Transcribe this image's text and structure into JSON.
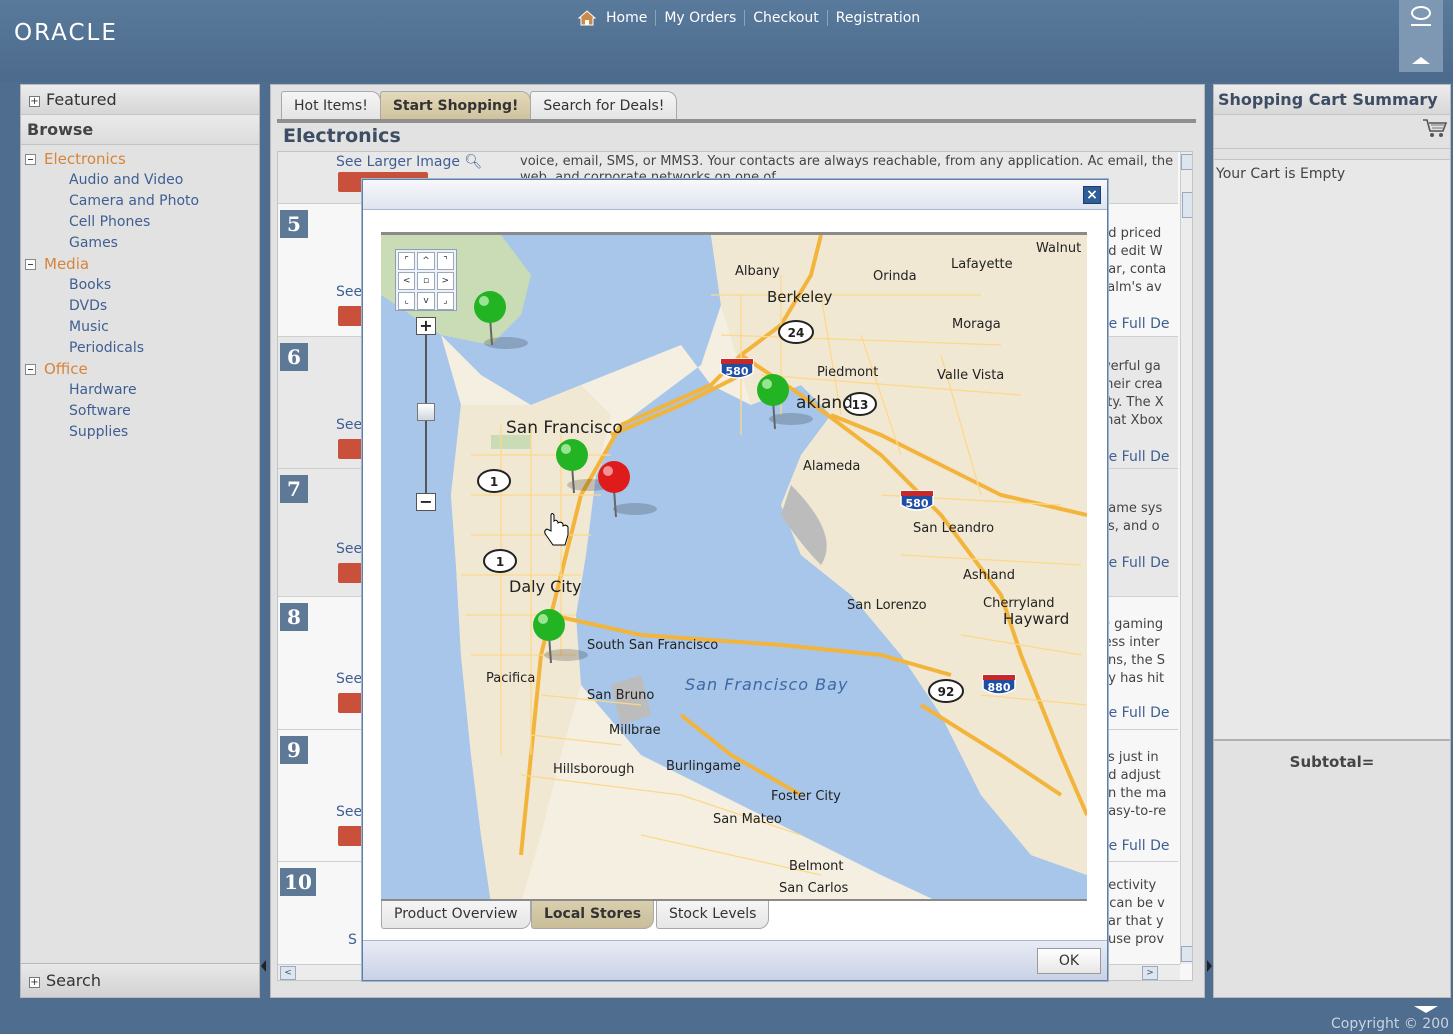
{
  "header": {
    "logo": "ORACLE",
    "logo_mark": "·",
    "nav": [
      "Home",
      "My Orders",
      "Checkout",
      "Registration"
    ]
  },
  "left": {
    "featured": "Featured",
    "browse": "Browse",
    "categories": [
      {
        "label": "Electronics",
        "items": [
          "Audio and Video",
          "Camera and Photo",
          "Cell Phones",
          "Games"
        ]
      },
      {
        "label": "Media",
        "items": [
          "Books",
          "DVDs",
          "Music",
          "Periodicals"
        ]
      },
      {
        "label": "Office",
        "items": [
          "Hardware",
          "Software",
          "Supplies"
        ]
      }
    ],
    "search": "Search"
  },
  "center": {
    "tabs": [
      "Hot Items!",
      "Start Shopping!",
      "Search for Deals!"
    ],
    "active_tab": "Start Shopping!",
    "section_title": "Electronics",
    "top_row": {
      "see_larger": "See Larger Image",
      "description": "voice, email, SMS, or MMS3. Your contacts are always reachable, from any application. Ac email, the web, and corporate networks on one of"
    },
    "rows": [
      {
        "num": "5",
        "see": "See",
        "desc": [
          "nd priced",
          "nd edit W",
          "dar, conta",
          "Palm's av"
        ],
        "link": "ee Full De"
      },
      {
        "num": "6",
        "see": "See",
        "desc": [
          "werful ga",
          "their crea",
          "lity. The X",
          "that Xbox"
        ],
        "link": "ee Full De"
      },
      {
        "num": "7",
        "see": "See",
        "desc": [
          "game sys",
          "os, and o"
        ],
        "link": "ee Full De"
      },
      {
        "num": "8",
        "see": "See",
        "desc": [
          "D gaming",
          "less inter",
          "ons, the S",
          "ny has hit"
        ],
        "link": "ee Full De"
      },
      {
        "num": "9",
        "see": "See",
        "desc": [
          "es just in",
          "nd adjust",
          "on the ma",
          "Easy-to-re"
        ],
        "link": "ee Full De"
      },
      {
        "num": "10",
        "see": "S",
        "desc": [
          "nectivity",
          "t can be v",
          "ear that y",
          "ouse prov"
        ],
        "link": ""
      }
    ]
  },
  "right": {
    "title": "Shopping Cart Summary",
    "empty": "Your Cart is Empty",
    "subtotal": "Subtotal="
  },
  "footer": {
    "copyright": "Copyright © 200"
  },
  "modal": {
    "ok": "OK",
    "tabs": [
      "Product Overview",
      "Local Stores",
      "Stock Levels"
    ],
    "active_tab": "Local Stores",
    "map": {
      "places": [
        "San Francisco",
        "Daly City",
        "South San Francisco",
        "Pacifica",
        "San Bruno",
        "Millbrae",
        "Hillsborough",
        "Burlingame",
        "Foster City",
        "San Mateo",
        "Belmont",
        "San Carlos",
        "Berkeley",
        "Albany",
        "Orinda",
        "Lafayette",
        "Walnut",
        "Moraga",
        "Piedmont",
        "akland",
        "Valle Vista",
        "Alameda",
        "San Leandro",
        "Ashland",
        "San Lorenzo",
        "Cherryland",
        "Hayward",
        "San Francisco Bay"
      ],
      "highways": [
        "24",
        "13",
        "1",
        "1",
        "92",
        "580",
        "580",
        "880"
      ],
      "pan": [
        "⌜",
        "^",
        "⌝",
        "<",
        "▫",
        ">",
        "⌞",
        "v",
        "⌟"
      ],
      "zoom_in": "+",
      "zoom_out": "−",
      "markers": [
        {
          "color": "green"
        },
        {
          "color": "green"
        },
        {
          "color": "green"
        },
        {
          "color": "red"
        },
        {
          "color": "green"
        }
      ]
    }
  },
  "colors": {
    "background": "#4e6d8f",
    "category": "#d7843a",
    "link": "#3f5f92",
    "badge": "#5e7996",
    "marker_green": "#22b422",
    "marker_red": "#e01b1b"
  }
}
